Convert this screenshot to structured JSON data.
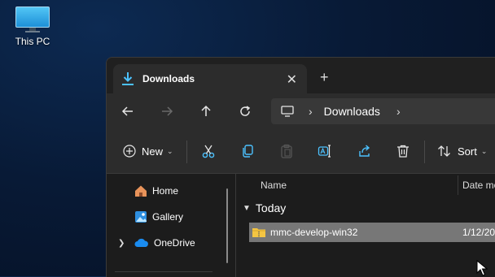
{
  "desktop": {
    "icon_label": "This PC"
  },
  "window": {
    "tab": {
      "title": "Downloads",
      "close": "✕"
    },
    "new_tab": "+",
    "address": {
      "crumb": "Downloads",
      "sep": "›"
    },
    "toolbar": {
      "new_label": "New",
      "sort_label": "Sort"
    },
    "sidebar": {
      "items": [
        "Home",
        "Gallery",
        "OneDrive"
      ]
    },
    "content": {
      "col_name": "Name",
      "col_date": "Date mo",
      "group": "Today",
      "files": [
        {
          "name": "mmc-develop-win32",
          "date": "1/12/20"
        }
      ]
    }
  },
  "colors": {
    "accent": "#4cc2ff",
    "folder": "#f4c542",
    "selection": "#777777"
  }
}
